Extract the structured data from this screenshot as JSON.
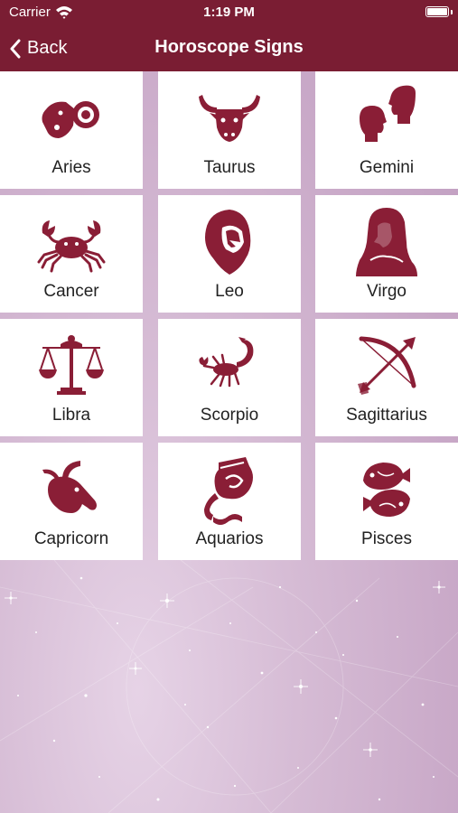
{
  "status_bar": {
    "carrier": "Carrier",
    "time": "1:19 PM"
  },
  "nav": {
    "back_label": "Back",
    "title": "Horoscope Signs"
  },
  "colors": {
    "accent": "#7a1d33",
    "icon": "#8a1e36"
  },
  "signs": [
    {
      "label": "Aries",
      "icon": "ram-icon"
    },
    {
      "label": "Taurus",
      "icon": "bull-icon"
    },
    {
      "label": "Gemini",
      "icon": "twins-icon"
    },
    {
      "label": "Cancer",
      "icon": "crab-icon"
    },
    {
      "label": "Leo",
      "icon": "lion-icon"
    },
    {
      "label": "Virgo",
      "icon": "maiden-icon"
    },
    {
      "label": "Libra",
      "icon": "scales-icon"
    },
    {
      "label": "Scorpio",
      "icon": "scorpion-icon"
    },
    {
      "label": "Sagittarius",
      "icon": "bow-arrow-icon"
    },
    {
      "label": "Capricorn",
      "icon": "goat-icon"
    },
    {
      "label": "Aquarios",
      "icon": "water-urn-icon"
    },
    {
      "label": "Pisces",
      "icon": "fish-icon"
    }
  ]
}
